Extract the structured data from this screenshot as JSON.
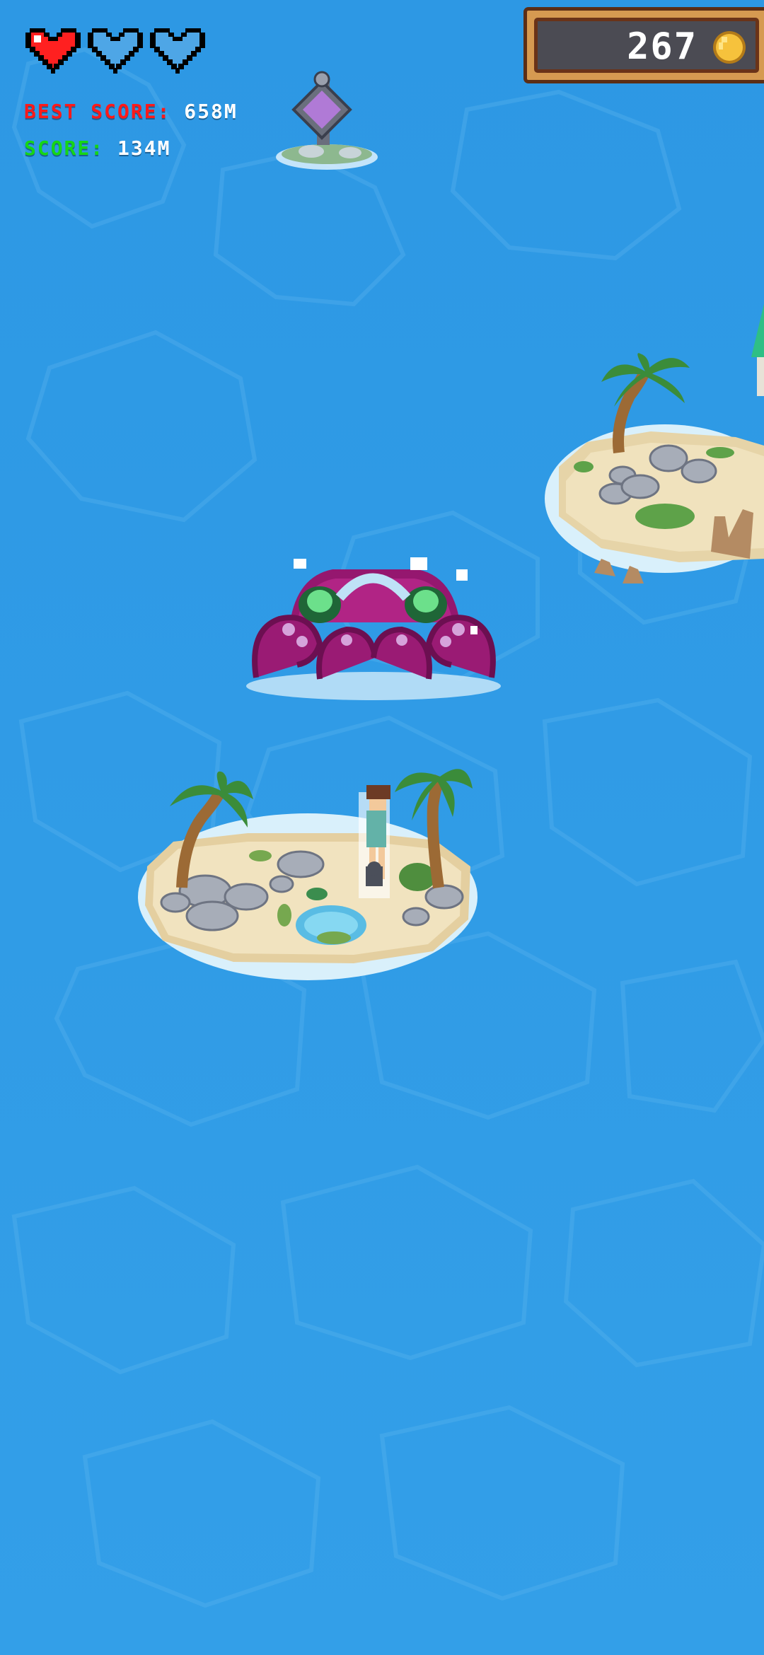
{
  "hud": {
    "lives": {
      "total": 3,
      "remaining": 1
    },
    "best_score": {
      "label": "BEST SCORE:",
      "value": "658M"
    },
    "score": {
      "label": "SCORE:",
      "value": "134M"
    },
    "coins": {
      "count": "267"
    }
  },
  "icons": {
    "heart_full": "heart-full-icon",
    "heart_empty": "heart-empty-icon",
    "coin": "coin-icon"
  },
  "colors": {
    "ocean": "#2f9ae6",
    "heart_full": "#ff2020",
    "heart_empty": "#4ea6e6",
    "best_score_label": "#ff1a1a",
    "score_label": "#16d616",
    "coin": "#f6c23c"
  }
}
